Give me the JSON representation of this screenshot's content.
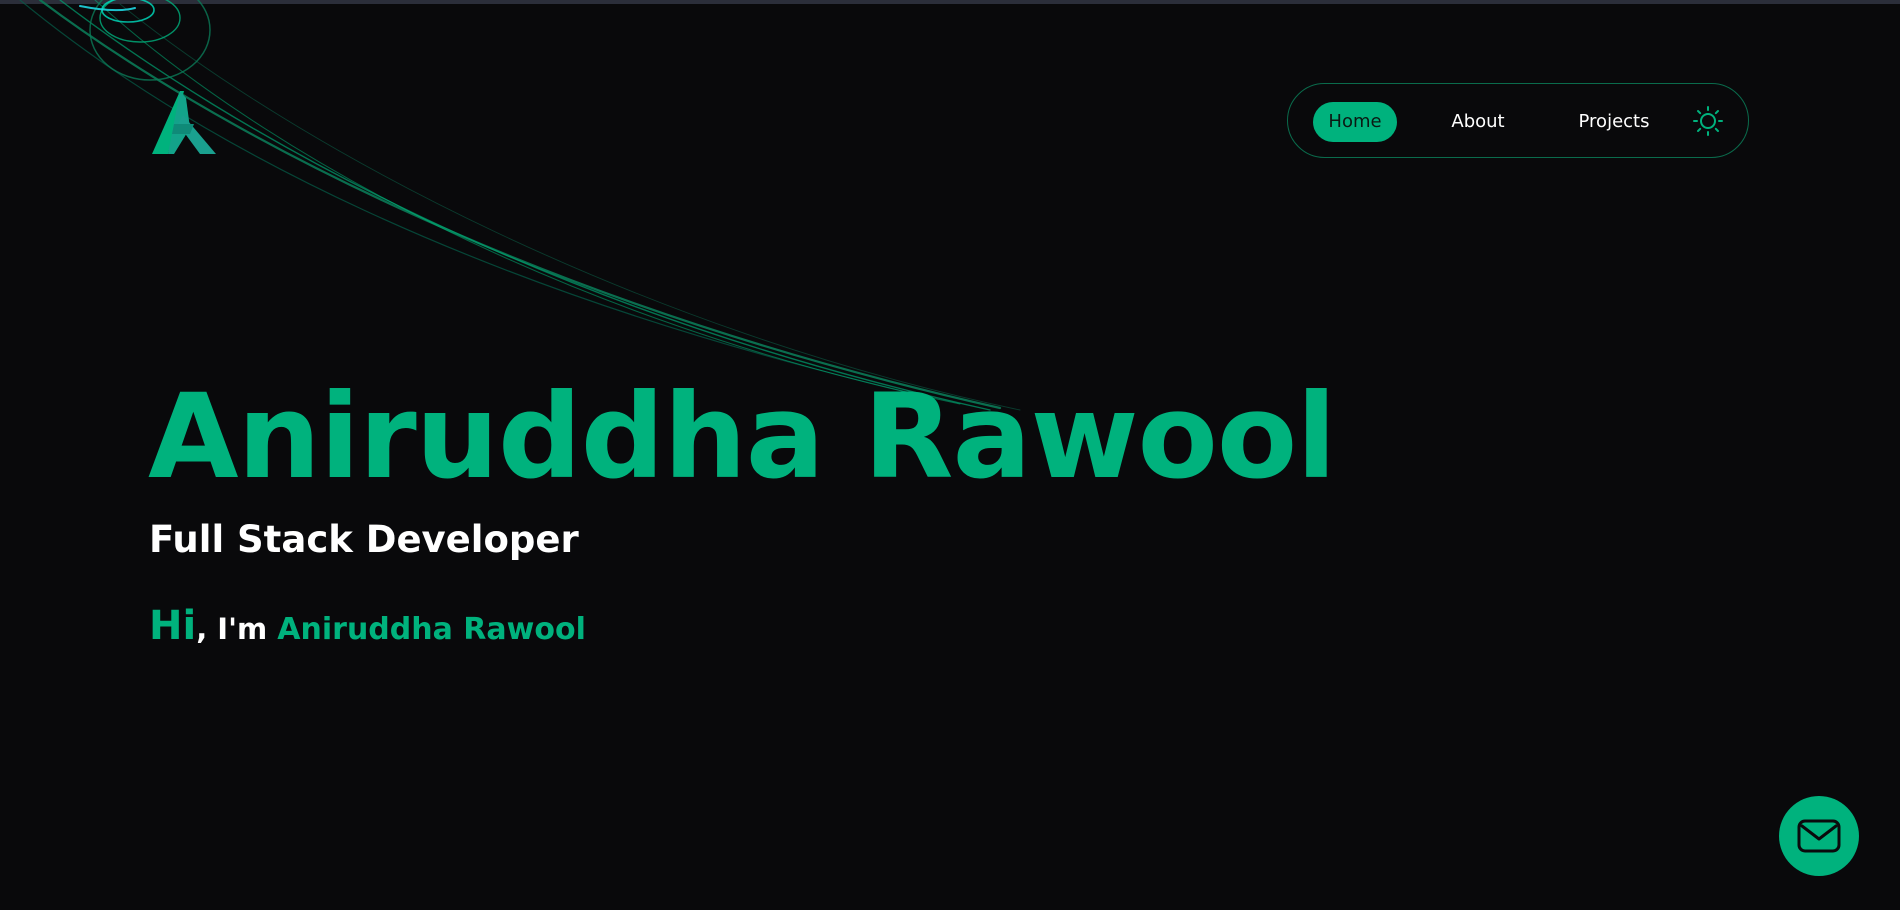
{
  "brand": {
    "logo_icon": "stylized-a-logo-icon",
    "accent_color": "#00b27d"
  },
  "nav": {
    "items": [
      {
        "label": "Home",
        "active": true
      },
      {
        "label": "About",
        "active": false
      },
      {
        "label": "Projects",
        "active": false
      }
    ],
    "theme_toggle_icon": "sun-icon"
  },
  "hero": {
    "name": "Aniruddha Rawool",
    "role": "Full Stack Developer",
    "greeting": {
      "hi": "Hi",
      "im": ", I'm ",
      "name": "Aniruddha Rawool"
    }
  },
  "contact": {
    "icon": "mail-icon"
  }
}
